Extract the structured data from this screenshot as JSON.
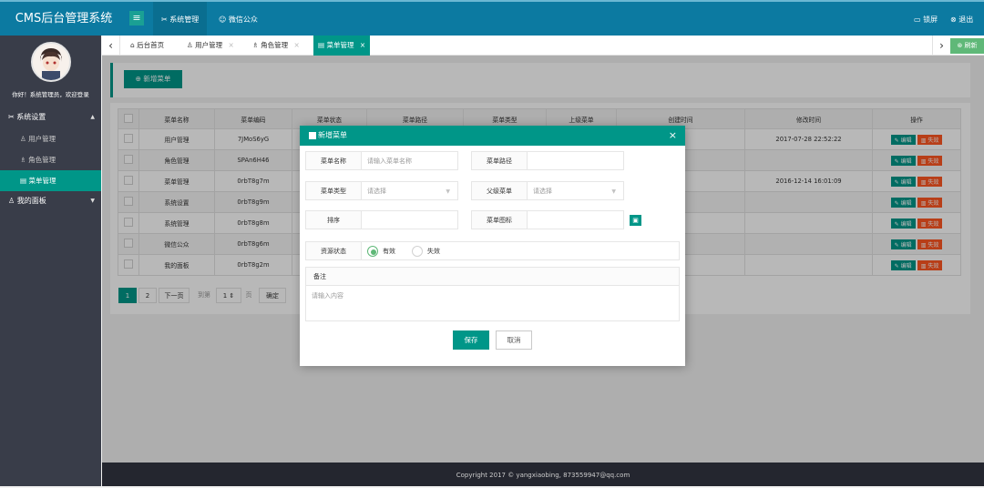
{
  "header": {
    "app_title": "CMS后台管理系统",
    "menu_toggle": "≡",
    "tabs": [
      {
        "label": "系统管理"
      },
      {
        "label": "微信公众"
      }
    ],
    "lock_label": "锁屏",
    "logout_label": "退出"
  },
  "sidebar": {
    "welcome": "你好！系统管理员，欢迎登录",
    "groups": [
      {
        "label": "系统设置",
        "items": [
          {
            "label": "用户管理"
          },
          {
            "label": "角色管理"
          },
          {
            "label": "菜单管理"
          }
        ]
      },
      {
        "label": "我的面板"
      }
    ]
  },
  "page_tabs": [
    {
      "label": "后台首页"
    },
    {
      "label": "用户管理"
    },
    {
      "label": "角色管理"
    },
    {
      "label": "菜单管理"
    }
  ],
  "refresh_label": "刷新",
  "toolbar": {
    "add_label": "新增菜单"
  },
  "table": {
    "headers": [
      "菜单名称",
      "菜单编码",
      "菜单状态",
      "菜单路径",
      "菜单类型",
      "上级菜单",
      "创建时间",
      "修改时间",
      "操作"
    ],
    "rows": [
      {
        "name": "用户管理",
        "code": "7JMoS6yG",
        "created": "",
        "modified": "2017-07-28 22:52:22"
      },
      {
        "name": "角色管理",
        "code": "SPAn6H46",
        "created": "",
        "modified": ""
      },
      {
        "name": "菜单管理",
        "code": "0rbT8g7m",
        "created": "",
        "modified": "2016-12-14 16:01:09"
      },
      {
        "name": "系统设置",
        "code": "0rbT8g9m",
        "created": "",
        "modified": ""
      },
      {
        "name": "系统管理",
        "code": "0rbT8g8m",
        "created": "",
        "modified": ""
      },
      {
        "name": "微信公众",
        "code": "0rbT8g6m",
        "created": "",
        "modified": ""
      },
      {
        "name": "我的面板",
        "code": "0rbT8g2m",
        "created": "",
        "modified": ""
      }
    ],
    "edit_label": "编辑",
    "disable_label": "失效"
  },
  "pager": {
    "pages": [
      "1",
      "2"
    ],
    "next_label": "下一页",
    "goto_label": "到第",
    "goto_value": "1",
    "page_unit": "页",
    "confirm_label": "确定"
  },
  "modal": {
    "title": "新增菜单",
    "close": "×",
    "fields": {
      "name_label": "菜单名称",
      "name_placeholder": "请输入菜单名称",
      "path_label": "菜单路径",
      "type_label": "菜单类型",
      "type_value": "请选择",
      "parent_label": "父级菜单",
      "parent_value": "请选择",
      "sort_label": "排序",
      "icon_label": "菜单图标",
      "status_label": "资源状态",
      "status_options": [
        {
          "label": "有效",
          "checked": true
        },
        {
          "label": "失效",
          "checked": false
        }
      ],
      "remark_label": "备注",
      "remark_placeholder": "请输入内容"
    },
    "save_label": "保存",
    "cancel_label": "取消"
  },
  "footer": {
    "text": "Copyright 2017 © yangxiaobing, 873559947@qq.com"
  },
  "colors": {
    "primary": "#009688",
    "header": "#0c7aa1",
    "sidebar": "#393d49",
    "danger": "#ff5722",
    "success": "#5fb878"
  }
}
